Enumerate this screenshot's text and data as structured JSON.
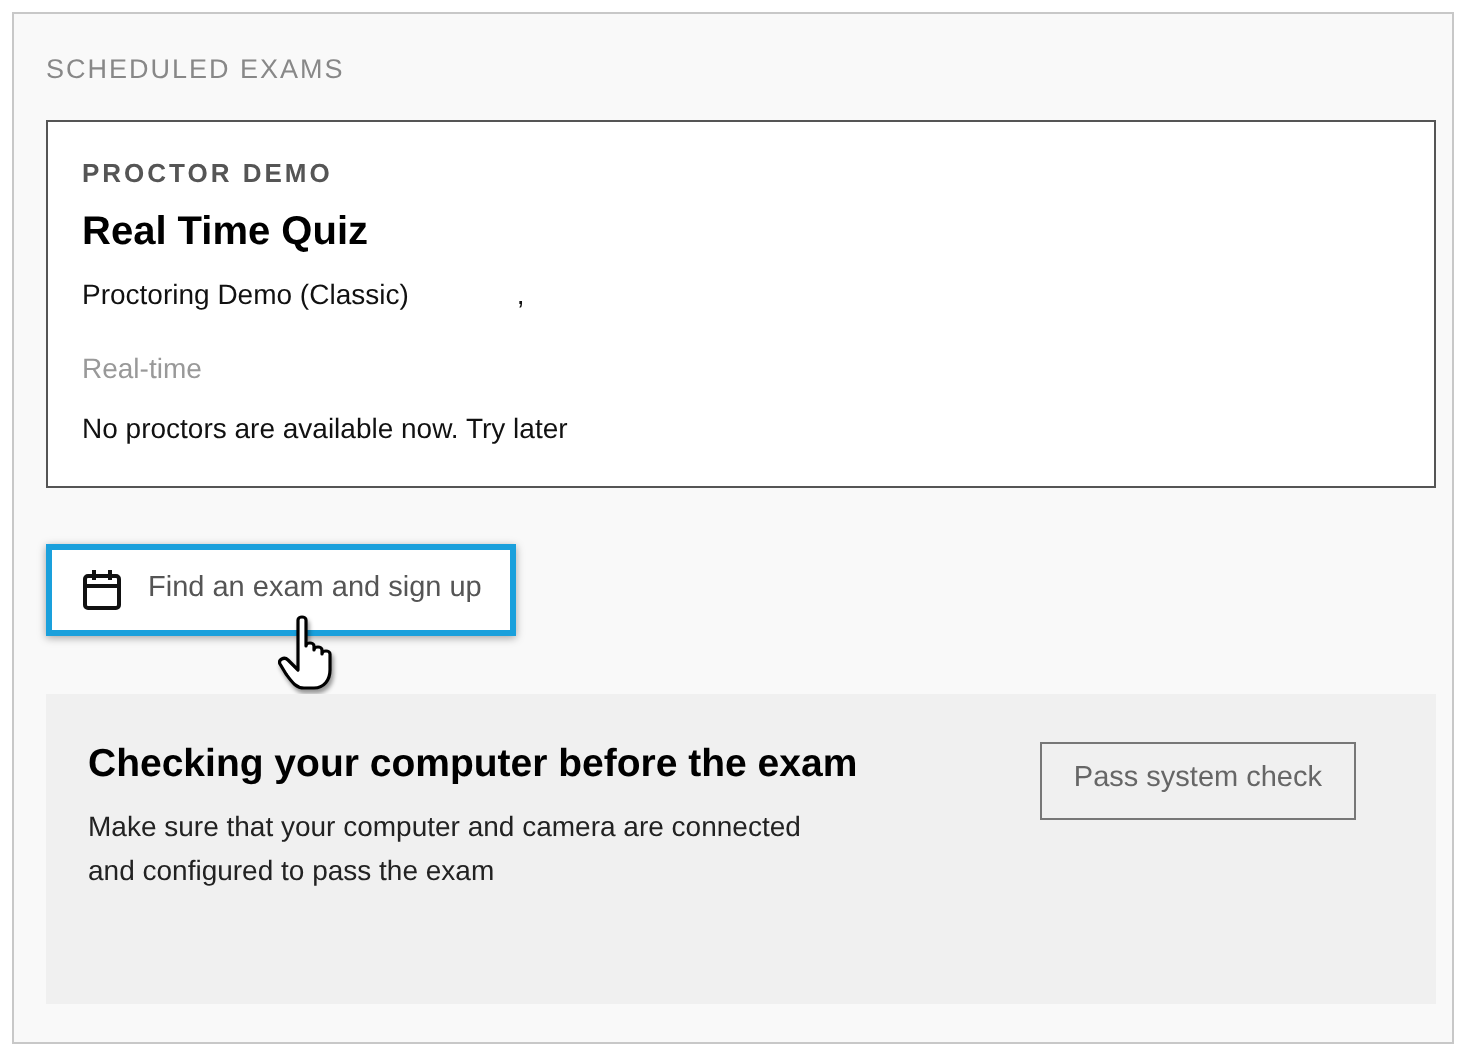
{
  "section_title": "SCHEDULED EXAMS",
  "exam": {
    "category": "PROCTOR DEMO",
    "title": "Real Time Quiz",
    "course": "Proctoring Demo (Classic)",
    "course_suffix": ",",
    "mode": "Real-time",
    "status": "No proctors are available now. Try later"
  },
  "find_button": {
    "label": "Find an exam and sign up",
    "highlighted": true
  },
  "system_check": {
    "title": "Checking your computer before the exam",
    "description": "Make sure that your computer and camera are connected and configured to pass the exam",
    "button": "Pass system check"
  }
}
